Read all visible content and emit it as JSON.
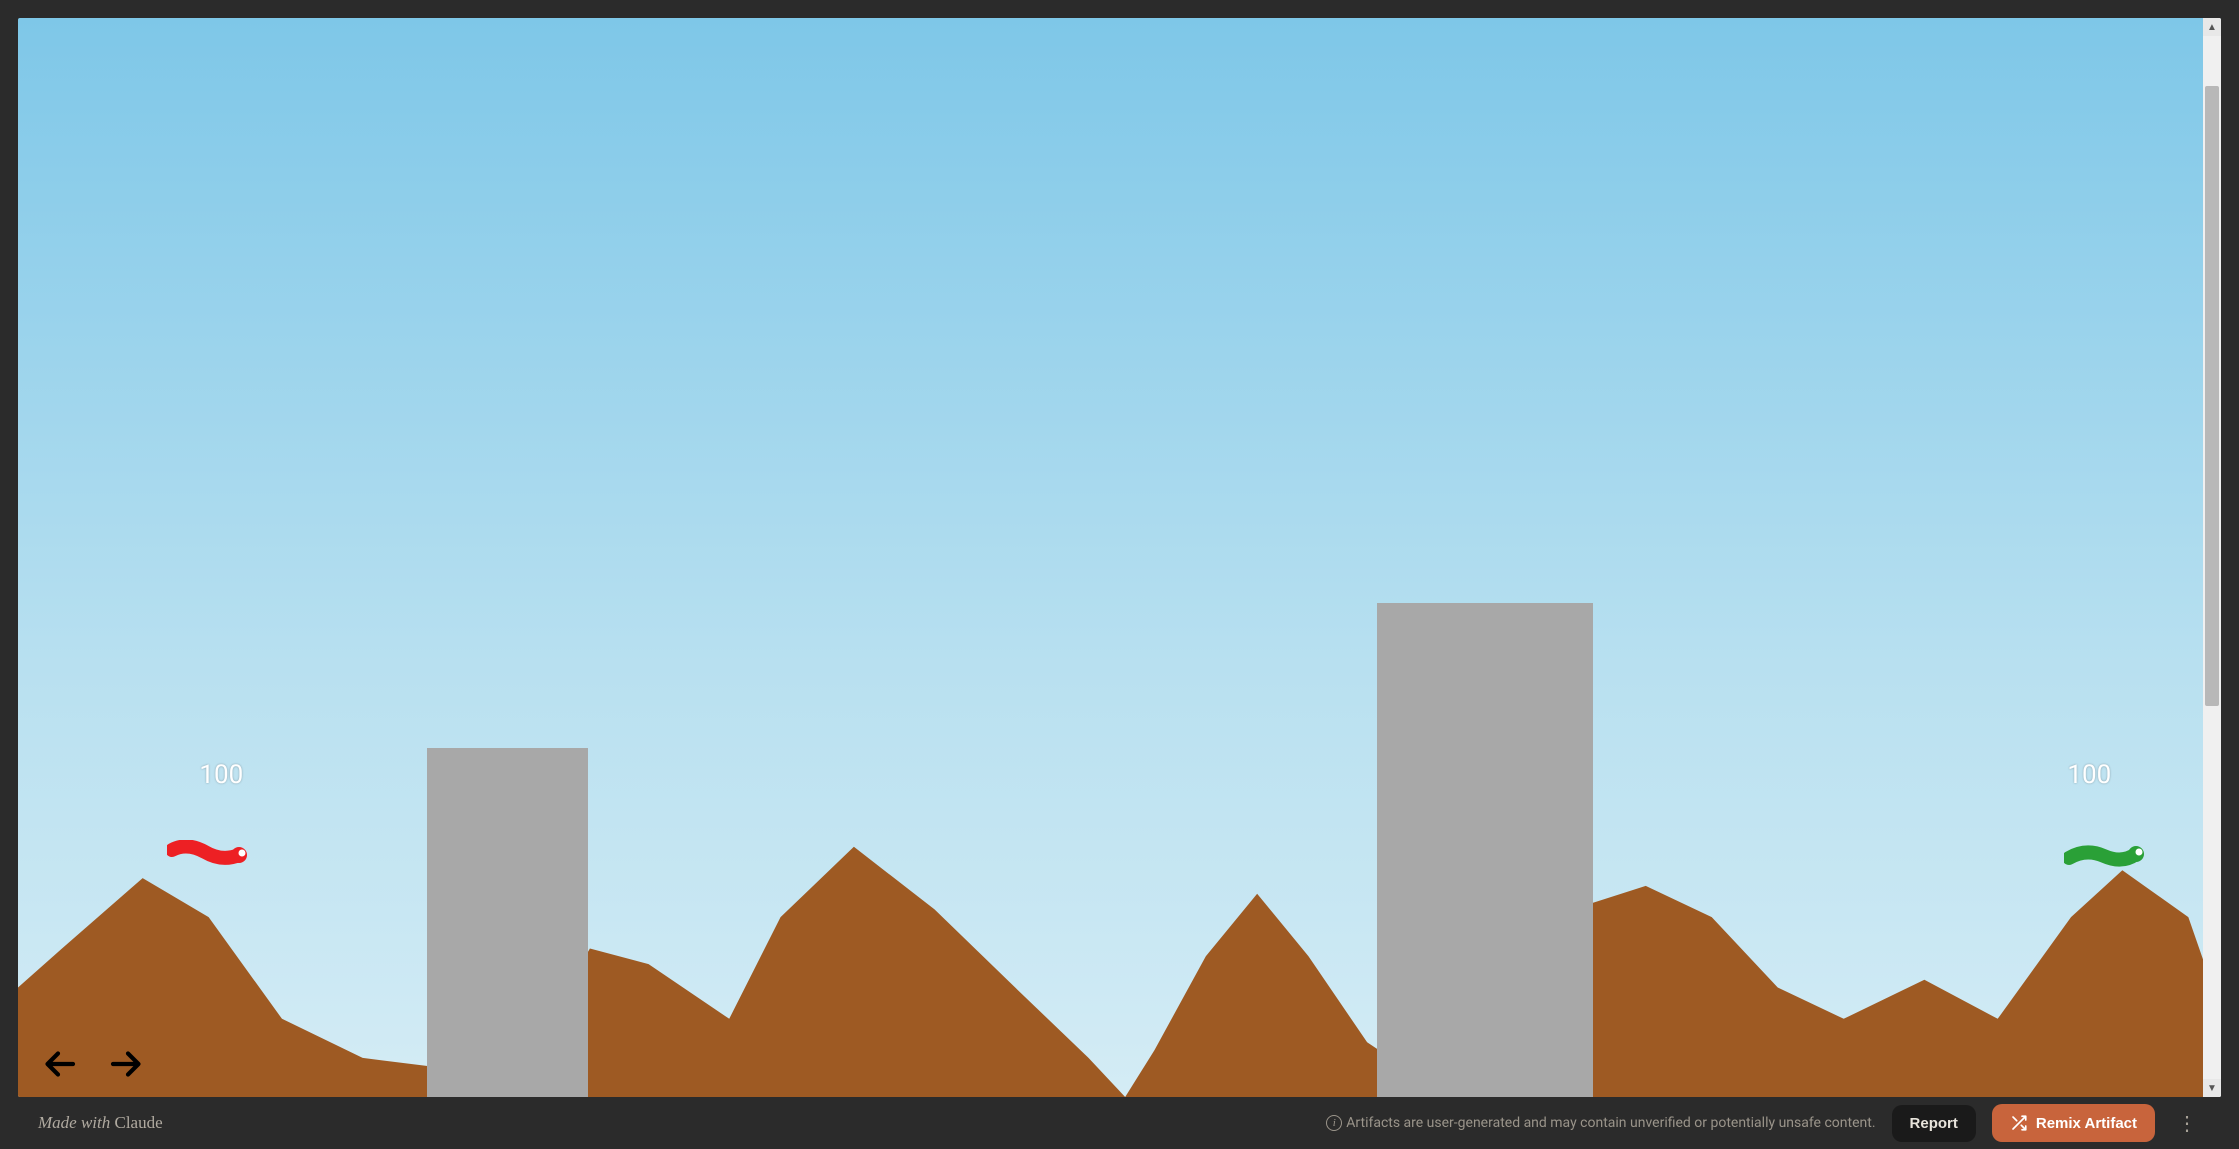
{
  "game": {
    "player_red_hp": "100",
    "player_green_hp": "100",
    "colors": {
      "sky_top": "#7ec7e8",
      "sky_bottom": "#d4ecf5",
      "terrain": "#9e5a23",
      "building": "#a8a8a8",
      "worm_red": "#ed2024",
      "worm_green": "#2aa037"
    }
  },
  "footer": {
    "made_with": "Made with ",
    "claude": "Claude",
    "disclaimer": "Artifacts are user-generated and may contain unverified or potentially unsafe content.",
    "report_label": "Report",
    "remix_label": "Remix Artifact"
  }
}
